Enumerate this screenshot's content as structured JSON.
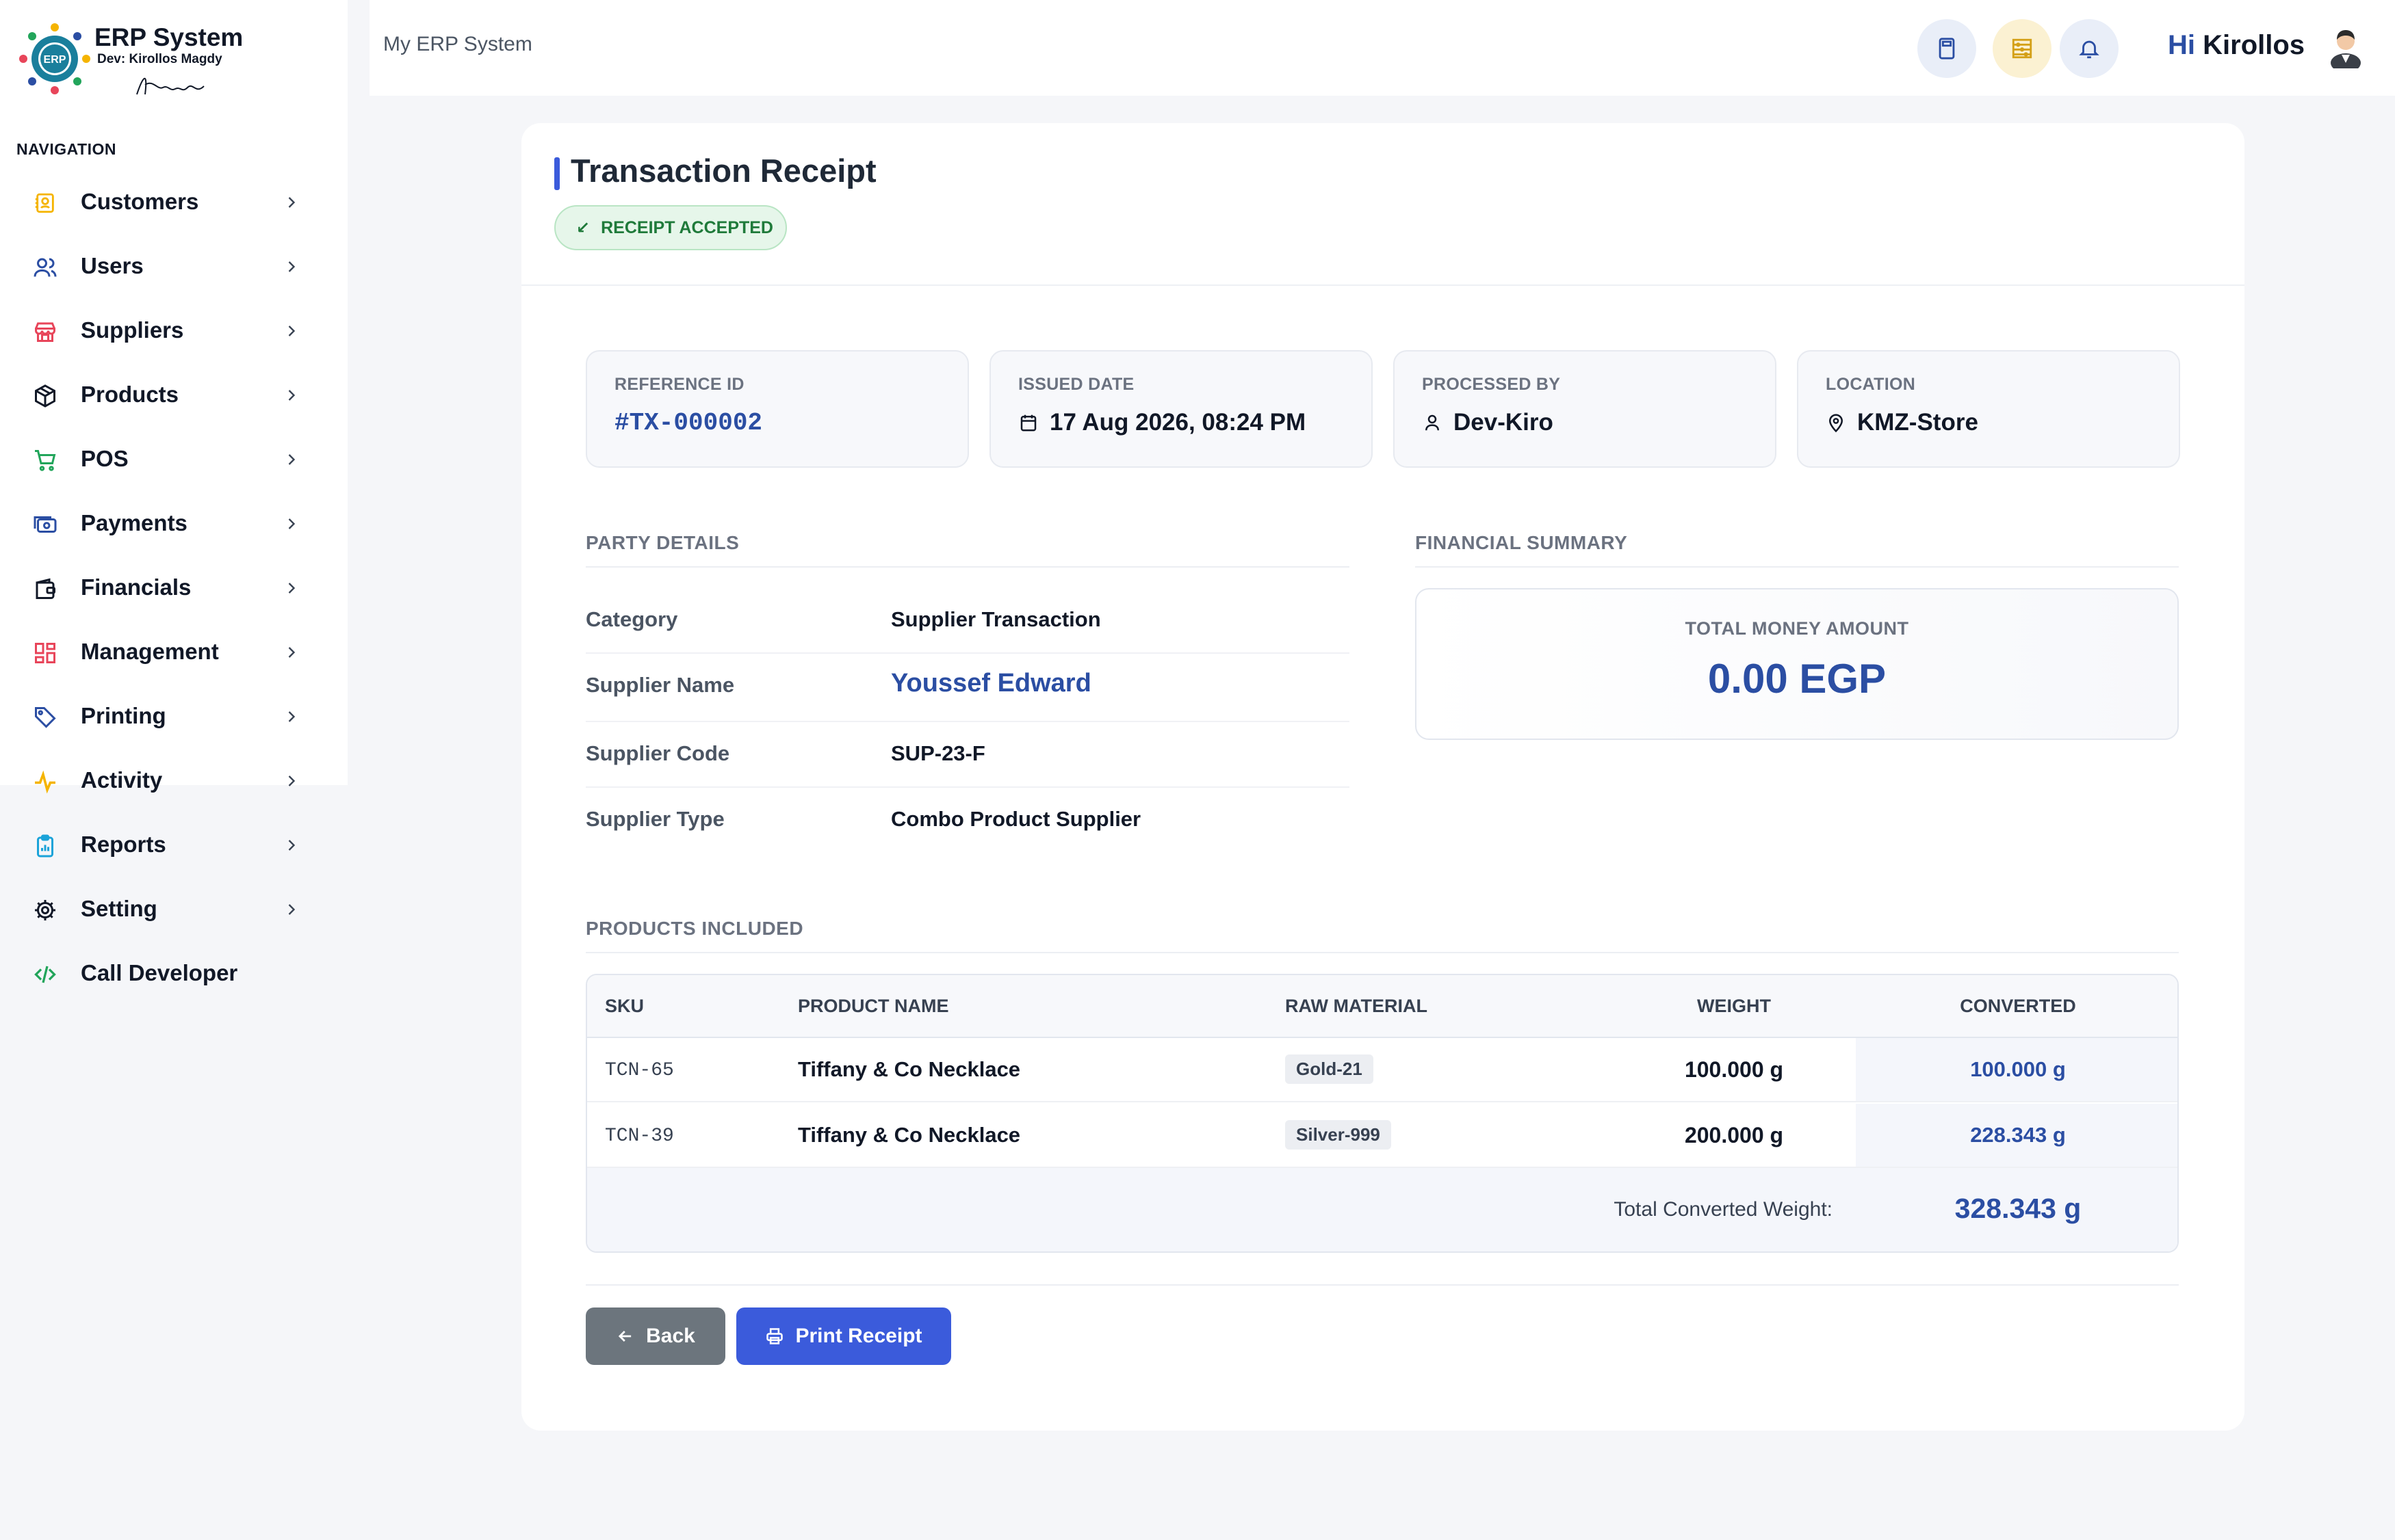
{
  "brand": {
    "title": "ERP System",
    "developer": "Dev: Kirollos Magdy",
    "logo_text": "ERP",
    "signature": "Kirollos"
  },
  "sidebar": {
    "heading": "NAVIGATION",
    "items": [
      {
        "label": "Customers",
        "icon": "contact-book-icon",
        "color": "#f5b400",
        "has_chevron": true
      },
      {
        "label": "Users",
        "icon": "users-icon",
        "color": "#2b4ea3",
        "has_chevron": true
      },
      {
        "label": "Suppliers",
        "icon": "store-icon",
        "color": "#e8455a",
        "has_chevron": true
      },
      {
        "label": "Products",
        "icon": "box-icon",
        "color": "#111827",
        "has_chevron": true
      },
      {
        "label": "POS",
        "icon": "cart-icon",
        "color": "#22a55b",
        "has_chevron": true
      },
      {
        "label": "Payments",
        "icon": "money-icon",
        "color": "#2b4ea3",
        "has_chevron": true
      },
      {
        "label": "Financials",
        "icon": "wallet-icon",
        "color": "#111827",
        "has_chevron": true
      },
      {
        "label": "Management",
        "icon": "dashboard-grid-icon",
        "color": "#e8455a",
        "has_chevron": true
      },
      {
        "label": "Printing",
        "icon": "tag-icon",
        "color": "#2b4ea3",
        "has_chevron": true
      },
      {
        "label": "Activity",
        "icon": "activity-pulse-icon",
        "color": "#f5b400",
        "has_chevron": true
      },
      {
        "label": "Reports",
        "icon": "clipboard-report-icon",
        "color": "#1aa3d9",
        "has_chevron": true
      },
      {
        "label": "Setting",
        "icon": "gear-icon",
        "color": "#111827",
        "has_chevron": true
      },
      {
        "label": "Call Developer",
        "icon": "code-icon",
        "color": "#22a55b",
        "has_chevron": false
      }
    ]
  },
  "topbar": {
    "breadcrumb": "My ERP System",
    "calculator_icon": "calculator-icon",
    "abacus_icon": "abacus-icon",
    "notification_icon": "bell-icon",
    "greeting_hi": "Hi",
    "user_name": "Kirollos"
  },
  "receipt": {
    "title": "Transaction Receipt",
    "status": "RECEIPT ACCEPTED",
    "info": {
      "reference_label": "REFERENCE ID",
      "reference_value": "#TX-000002",
      "date_label": "ISSUED DATE",
      "date_value": "17 Aug 2026, 08:24 PM",
      "processed_label": "PROCESSED BY",
      "processed_value": "Dev-Kiro",
      "location_label": "LOCATION",
      "location_value": "KMZ-Store"
    },
    "party": {
      "heading": "PARTY DETAILS",
      "rows": [
        {
          "label": "Category",
          "value": "Supplier Transaction"
        },
        {
          "label": "Supplier Name",
          "value": "Youssef Edward"
        },
        {
          "label": "Supplier Code",
          "value": "SUP-23-F"
        },
        {
          "label": "Supplier Type",
          "value": "Combo Product Supplier"
        }
      ]
    },
    "financial": {
      "heading": "FINANCIAL SUMMARY",
      "label": "TOTAL MONEY AMOUNT",
      "value": "0.00 EGP"
    },
    "products": {
      "heading": "PRODUCTS INCLUDED",
      "columns": [
        "SKU",
        "PRODUCT NAME",
        "RAW MATERIAL",
        "WEIGHT",
        "CONVERTED"
      ],
      "rows": [
        {
          "sku": "TCN-65",
          "name": "Tiffany & Co Necklace",
          "material": "Gold-21",
          "weight": "100.000 g",
          "converted": "100.000 g"
        },
        {
          "sku": "TCN-39",
          "name": "Tiffany & Co Necklace",
          "material": "Silver-999",
          "weight": "200.000 g",
          "converted": "228.343 g"
        }
      ],
      "total_label": "Total Converted Weight:",
      "total_value": "328.343 g"
    },
    "actions": {
      "back_label": "Back",
      "print_label": "Print Receipt"
    }
  },
  "colors": {
    "accent": "#3b5bdb",
    "link": "#2b4ea3",
    "success_bg": "#e6f6ea",
    "success_text": "#1f7a3a",
    "back_button": "#6c757d"
  }
}
